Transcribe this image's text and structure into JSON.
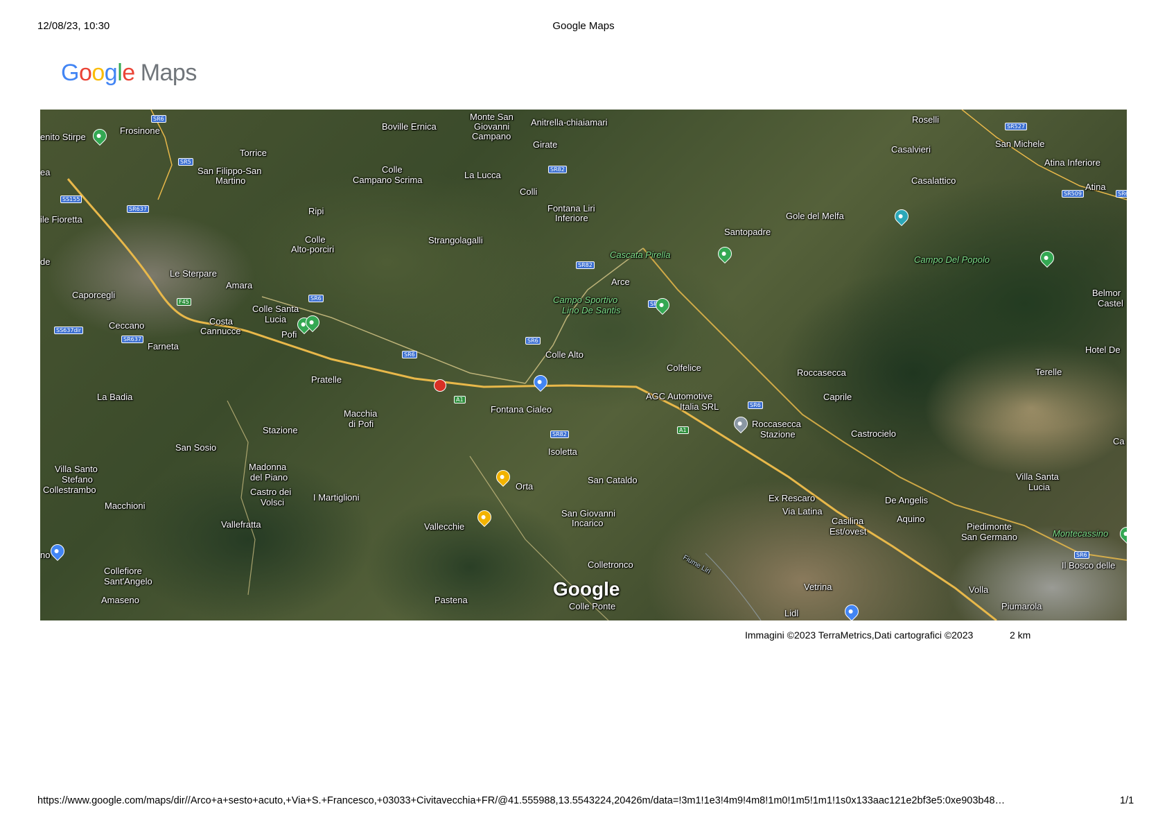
{
  "header": {
    "date": "12/08/23, 10:30",
    "title": "Google Maps"
  },
  "logo": {
    "letters": [
      "G",
      "o",
      "o",
      "g",
      "l",
      "e"
    ],
    "product": "Maps"
  },
  "map": {
    "type": "satellite",
    "watermark": "Google",
    "labels": [
      "enito Stirpe",
      "Frosinone",
      "Torrice",
      "San Filippo-San",
      "Martino",
      "ile Fioretta",
      "Boville Ernica",
      "Monte San",
      "Giovanni",
      "Campano",
      "Anitrella-chiaiamari",
      "Girate",
      "Colle",
      "Campano Scrima",
      "La Lucca",
      "Colli",
      "Fontana Liri",
      "Inferiore",
      "Ripi",
      "Colle",
      "Alto-porciri",
      "Strangolagalli",
      "Le Sterpare",
      "Amara",
      "Caporcegli",
      "Colle Santa",
      "Lucia",
      "Pofi",
      "Ceccano",
      "Costa",
      "Cannucce",
      "Farneta",
      "Arce",
      "Colle Alto",
      "Pratelle",
      "Fontana Cialeo",
      "Colfelice",
      "La Badia",
      "Macchia",
      "di Pofi",
      "Stazione",
      "San Sosio",
      "Isoletta",
      "AGC Automotive",
      "Italia SRL",
      "Roccasecca",
      "Stazione",
      "Roccasecca",
      "Caprile",
      "Castrocielo",
      "Villa Santo",
      "Stefano",
      "Collestrambo",
      "Madonna",
      "del Piano",
      "Castro dei",
      "Volsci",
      "I Martiglioni",
      "Orta",
      "San Cataldo",
      "San Giovanni",
      "Incarico",
      "Macchioni",
      "Vallefratta",
      "Vallecchie",
      "Ex Rescaro",
      "Via Latina",
      "Casilina",
      "Est/ovest",
      "De Angelis",
      "Aquino",
      "Piedimonte",
      "San Germano",
      "Collefiore",
      "Sant'Angelo",
      "Amaseno",
      "Pastena",
      "Colletronco",
      "Colle Ponte",
      "Vetrina",
      "Lidl",
      "Volla",
      "Piumarola",
      "Roselli",
      "Casalvieri",
      "Casalattico",
      "San Michele",
      "Atina Inferiore",
      "Atina",
      "Santopadre",
      "Gole del Melfa",
      "Campo Del Popolo",
      "Terelle",
      "Villa Santa",
      "Lucia",
      "Montecassino",
      "Il Bosco delle",
      "Belmor",
      "Castel",
      "Hotel De",
      "Ca",
      "no",
      "de",
      "ea",
      "Cascata Pirella",
      "Campo Sportivo",
      "Lino De Santis",
      "Fiume Liri"
    ],
    "road_shields": [
      "SR6",
      "SR5",
      "SS155",
      "SR637",
      "F45",
      "SR6",
      "SS637dir",
      "SR637",
      "SR6",
      "SR6",
      "A1",
      "SR82",
      "SR82",
      "SR82",
      "SR6",
      "SR6",
      "A1",
      "SR527",
      "SR509",
      "SR6",
      "SR6"
    ],
    "colors": {
      "highway": "#e8b84a",
      "road": "#d9c98a",
      "poi_green": "#34a853",
      "pin_blue": "#4285F4"
    }
  },
  "attribution": "Immagini ©2023 TerraMetrics,Dati cartografici ©2023",
  "scale": "2 km",
  "footer": {
    "url": "https://www.google.com/maps/dir//Arco+a+sesto+acuto,+Via+S.+Francesco,+03033+Civitavecchia+FR/@41.555988,13.5543224,20426m/data=!3m1!1e3!4m9!4m8!1m0!1m5!1m1!1s0x133aac121e2bf3e5:0xe903b48…",
    "page": "1/1"
  }
}
